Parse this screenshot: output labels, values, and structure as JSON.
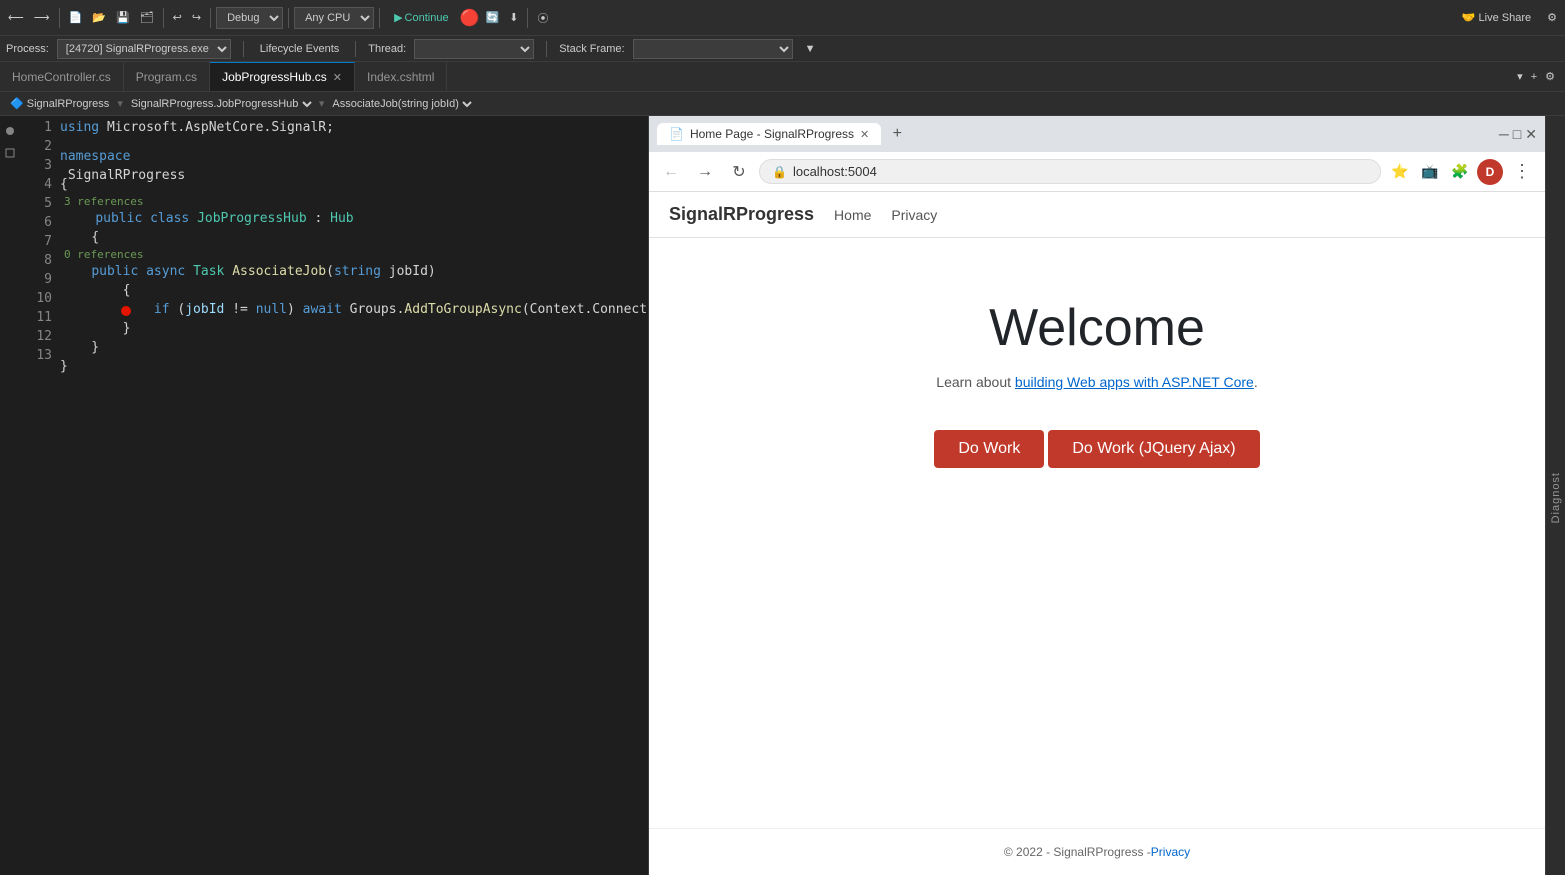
{
  "toolbar": {
    "debug_config": "Debug",
    "cpu_config": "Any CPU",
    "continue_label": "Continue",
    "live_share_label": "Live Share",
    "process_label": "Process:",
    "process_value": "[24720] SignalRProgress.exe",
    "lifecycle_label": "Lifecycle Events",
    "thread_label": "Thread:",
    "stack_frame_label": "Stack Frame:"
  },
  "tabs": [
    {
      "label": "HomeController.cs",
      "active": false,
      "closeable": false
    },
    {
      "label": "Program.cs",
      "active": false,
      "closeable": false
    },
    {
      "label": "JobProgressHub.cs",
      "active": true,
      "closeable": true
    },
    {
      "label": "Index.cshtml",
      "active": false,
      "closeable": false
    }
  ],
  "editor_nav": {
    "project": "SignalRProgress",
    "class": "SignalRProgress.JobProgressHub",
    "method": "AssociateJob(string jobId)"
  },
  "code": {
    "lines": [
      {
        "num": 1,
        "text": "using Microsoft.AspNetCore.SignalR;",
        "parts": [
          {
            "t": "kw",
            "v": "using"
          },
          {
            "t": "plain",
            "v": " Microsoft.AspNetCore.SignalR;"
          }
        ]
      },
      {
        "num": 2,
        "text": "",
        "parts": []
      },
      {
        "num": 3,
        "text": "namespace SignalRProgress",
        "parts": [
          {
            "t": "kw",
            "v": "namespace"
          },
          {
            "t": "plain",
            "v": " SignalRProgress"
          }
        ],
        "ref_hint": null
      },
      {
        "num": 4,
        "text": "{",
        "parts": [
          {
            "t": "plain",
            "v": "{"
          }
        ]
      },
      {
        "num": 5,
        "text": "    public class JobProgressHub : Hub",
        "parts": [
          {
            "t": "hint",
            "v": "3 references"
          },
          {
            "t": "kw",
            "v": "    public"
          },
          {
            "t": "kw",
            "v": " class"
          },
          {
            "t": "type",
            "v": " JobProgressHub"
          },
          {
            "t": "plain",
            "v": " : "
          },
          {
            "t": "type",
            "v": "Hub"
          }
        ],
        "hint": "3 references"
      },
      {
        "num": 6,
        "text": "    {",
        "parts": [
          {
            "t": "plain",
            "v": "    {"
          }
        ]
      },
      {
        "num": 7,
        "text": "        public async Task AssociateJob(string jobId)",
        "parts": [
          {
            "t": "hint",
            "v": "0 references"
          },
          {
            "t": "kw",
            "v": "        public"
          },
          {
            "t": "kw",
            "v": " async"
          },
          {
            "t": "type",
            "v": " Task"
          },
          {
            "t": "method",
            "v": " AssociateJob"
          },
          {
            "t": "plain",
            "v": "("
          },
          {
            "t": "kw",
            "v": "string"
          },
          {
            "t": "plain",
            "v": " jobId)"
          }
        ],
        "hint": "0 references"
      },
      {
        "num": 8,
        "text": "        {",
        "parts": [
          {
            "t": "plain",
            "v": "        {"
          }
        ],
        "breakpoint": true
      },
      {
        "num": 9,
        "text": "            if (jobId != null) await Groups.AddToGroupAsync(Context.ConnectionId, jo",
        "parts": [
          {
            "t": "kw",
            "v": "            if"
          },
          {
            "t": "plain",
            "v": " ("
          },
          {
            "t": "ref",
            "v": "jobId"
          },
          {
            "t": "plain",
            "v": " != "
          },
          {
            "t": "kw",
            "v": "null"
          },
          {
            "t": "plain",
            "v": ") "
          },
          {
            "t": "kw",
            "v": "await"
          },
          {
            "t": "plain",
            "v": " Groups."
          },
          {
            "t": "method",
            "v": "AddToGroupAsync"
          },
          {
            "t": "plain",
            "v": "(Context.ConnectionId, jo"
          }
        ]
      },
      {
        "num": 10,
        "text": "        }",
        "parts": [
          {
            "t": "plain",
            "v": "        }"
          }
        ]
      },
      {
        "num": 11,
        "text": "    }",
        "parts": [
          {
            "t": "plain",
            "v": "    }"
          }
        ]
      },
      {
        "num": 12,
        "text": "}",
        "parts": [
          {
            "t": "plain",
            "v": "}"
          }
        ]
      },
      {
        "num": 13,
        "text": "",
        "parts": []
      }
    ]
  },
  "browser": {
    "tab_title": "Home Page - SignalRProgress",
    "url": "localhost:5004",
    "profile_initial": "D"
  },
  "website": {
    "brand": "SignalRProgress",
    "nav_links": [
      "Home",
      "Privacy"
    ],
    "welcome_heading": "Welcome",
    "subtitle_text": "Learn about ",
    "subtitle_link": "building Web apps with ASP.NET Core",
    "subtitle_end": ".",
    "do_work_label": "Do Work",
    "do_work_jquery_label": "Do Work (JQuery Ajax)",
    "footer_text": "© 2022 - SignalRProgress - ",
    "footer_link": "Privacy"
  },
  "right_sidebar": {
    "label": "Diagnost"
  }
}
